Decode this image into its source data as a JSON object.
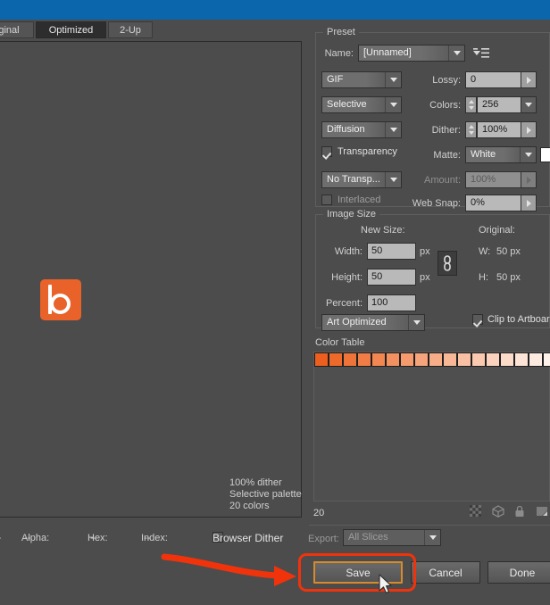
{
  "window": {
    "accent_blue": "#0b66ab"
  },
  "tabs": [
    {
      "label": "ginal",
      "selected": false
    },
    {
      "label": "Optimized",
      "selected": true
    },
    {
      "label": "2-Up",
      "selected": false
    }
  ],
  "preview": {
    "info_lines": [
      "100% dither",
      "Selective palette",
      "20 colors"
    ],
    "logo_color": "#e8622a"
  },
  "info_bar": {
    "dash": "--",
    "alpha_label": "Alpha:",
    "alpha_value": "--",
    "hex_label": "Hex:",
    "hex_value": "--",
    "index_label": "Index:",
    "index_value": "--",
    "browser_dither_label": "Browser Dither",
    "browser_dither_checked": false
  },
  "preset": {
    "group_label": "Preset",
    "name_label": "Name:",
    "name_value": "[Unnamed]",
    "menu_icon": "preset-menu-icon",
    "format_value": "GIF",
    "lossy_label": "Lossy:",
    "lossy_value": "0",
    "palette_value": "Selective",
    "colors_label": "Colors:",
    "colors_value": "256",
    "dither_algo_value": "Diffusion",
    "dither_label": "Dither:",
    "dither_value": "100%",
    "transparency_label": "Transparency",
    "transparency_checked": true,
    "matte_label": "Matte:",
    "matte_value": "White",
    "matte_swatch": "#ffffff",
    "transparency_dither_value": "No Transp...",
    "amount_label": "Amount:",
    "amount_value": "100%",
    "amount_enabled": false,
    "interlaced_label": "Interlaced",
    "interlaced_checked": false,
    "web_snap_label": "Web Snap:",
    "web_snap_value": "0%"
  },
  "image_size": {
    "group_label": "Image Size",
    "new_size_label": "New Size:",
    "original_label": "Original:",
    "width_label": "Width:",
    "width_value": "50",
    "width_unit": "px",
    "height_label": "Height:",
    "height_value": "50",
    "height_unit": "px",
    "percent_label": "Percent:",
    "percent_value": "100",
    "link_icon": "chain-link-icon",
    "orig_w_label": "W:",
    "orig_w_value": "50 px",
    "orig_h_label": "H:",
    "orig_h_value": "50 px",
    "quality_value": "Art Optimized",
    "clip_label": "Clip to Artboard",
    "clip_checked": true
  },
  "color_table": {
    "label": "Color Table",
    "count": "20",
    "swatches": [
      "#ec5f1f",
      "#ee6a2b",
      "#ef7439",
      "#f07d45",
      "#f28752",
      "#f39160",
      "#f59b6e",
      "#f6a47b",
      "#f7ad88",
      "#f8b795",
      "#f9c0a3",
      "#fac9b0",
      "#fbd2bd",
      "#fcdbca",
      "#fde4d7",
      "#fdeae0",
      "#fef2eb",
      "#fefaf7",
      "#ffffff"
    ],
    "transparency_swatch": "checkerboard",
    "icons": [
      "checkerboard-icon",
      "web-safe-cube-icon",
      "lock-icon",
      "new-swatch-icon"
    ]
  },
  "export": {
    "label": "Export:",
    "value": "All Slices"
  },
  "buttons": {
    "save": "Save",
    "cancel": "Cancel",
    "done": "Done"
  }
}
